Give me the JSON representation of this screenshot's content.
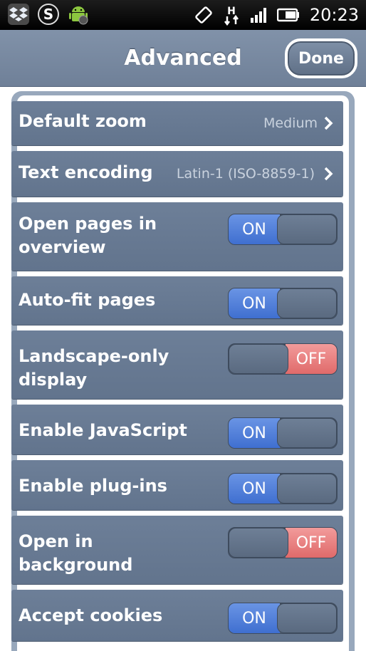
{
  "status_bar": {
    "time": "20:23",
    "notification_icons": [
      "dropbox-icon",
      "skype-icon",
      "android-debug-icon"
    ],
    "status_icons": [
      "rotation-icon",
      "data-transfer-icon",
      "signal-icon",
      "battery-icon"
    ]
  },
  "header": {
    "title": "Advanced",
    "done_label": "Done"
  },
  "settings": [
    {
      "label": "Default zoom",
      "value": "Medium",
      "type": "chevron"
    },
    {
      "label": "Text encoding",
      "value": "Latin-1 (ISO-8859-1)",
      "type": "chevron"
    },
    {
      "label_line1": "Open pages in",
      "label_line2": "overview",
      "type": "toggle",
      "state": "ON"
    },
    {
      "label": "Auto-fit pages",
      "type": "toggle",
      "state": "ON"
    },
    {
      "label_line1": "Landscape-only",
      "label_line2": "display",
      "type": "toggle",
      "state": "OFF"
    },
    {
      "label": "Enable JavaScript",
      "type": "toggle",
      "state": "ON"
    },
    {
      "label": "Enable plug-ins",
      "type": "toggle",
      "state": "ON"
    },
    {
      "label_line1": "Open in",
      "label_line2": "background",
      "type": "toggle",
      "state": "OFF"
    },
    {
      "label": "Accept cookies",
      "type": "toggle",
      "state": "ON"
    }
  ],
  "colors": {
    "toggle_on": "#4f7fdc",
    "toggle_off": "#e87b7b",
    "row_bg": "#6a7c95",
    "header_bg": "#7a8ba2"
  }
}
